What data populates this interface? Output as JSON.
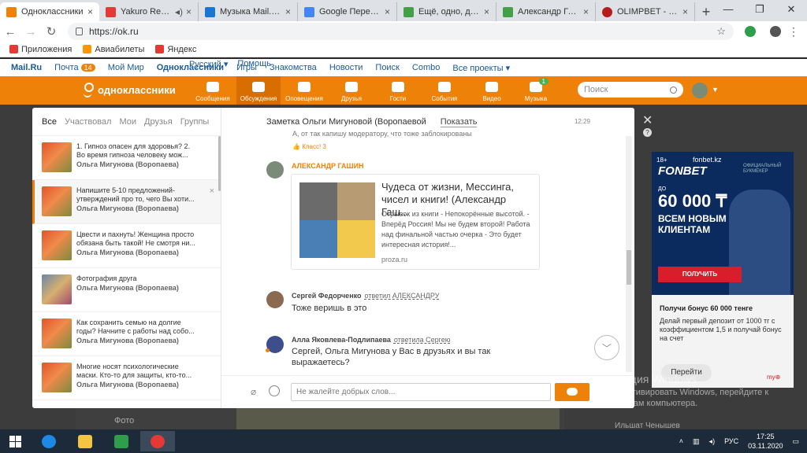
{
  "browser": {
    "tabs": [
      {
        "title": "Одноклассники",
        "color": "#ee8208",
        "active": true
      },
      {
        "title": "Yakuro Return",
        "color": "#e53935"
      },
      {
        "title": "Музыка Mail.Ru – ",
        "color": "#1976d2"
      },
      {
        "title": "Google Переводч",
        "color": "#4285f4"
      },
      {
        "title": "Ещё, одно, доказ",
        "color": "#43a047"
      },
      {
        "title": "Александр Гашин",
        "color": "#43a047"
      },
      {
        "title": "OLIMPBET - Списо",
        "color": "#b71c1c"
      }
    ],
    "newtab": "+",
    "url": "https://ok.ru",
    "bookmarks": [
      {
        "label": "Приложения",
        "color": "#e53935"
      },
      {
        "label": "Авиабилеты",
        "color": "#ff9800"
      },
      {
        "label": "Яндекс",
        "color": "#e53935"
      }
    ]
  },
  "portal": {
    "left": [
      "Mail.Ru",
      "Почта",
      "Мой Мир",
      "Одноклассники",
      "Игры",
      "Знакомства",
      "Новости",
      "Поиск",
      "Combo",
      "Все проекты ▾"
    ],
    "mail_count": "14",
    "lang": "Русский ▾",
    "help": "Помощь"
  },
  "ok": {
    "logo": "одноклассники",
    "nav": [
      {
        "label": "Сообщения"
      },
      {
        "label": "Обсуждения",
        "active": true
      },
      {
        "label": "Оповещения"
      },
      {
        "label": "Друзья"
      },
      {
        "label": "Гости"
      },
      {
        "label": "События"
      },
      {
        "label": "Видео"
      },
      {
        "label": "Музыка",
        "count": "1"
      }
    ],
    "search_placeholder": "Поиск"
  },
  "discussions": {
    "tabs": [
      "Все",
      "Участвовал",
      "Мои",
      "Друзья",
      "Группы"
    ],
    "items": [
      {
        "line1": "1. Гипноз опасен для здоровья? 2.",
        "line2": "Во время гипноза человеку мож...",
        "author": "Ольга Мигунова (Воропаева)"
      },
      {
        "line1": "Напишите 5-10 предложений-",
        "line2": "утверждений про то, чего Вы хоти...",
        "author": "Ольга Мигунова (Воропаева)",
        "selected": true
      },
      {
        "line1": "Цвести и пахнуть! Женщина просто",
        "line2": "обязана быть такой! Не смотря ни...",
        "author": "Ольга Мигунова (Воропаева)"
      },
      {
        "line1": "Фотография друга",
        "line2": "",
        "author": "Ольга Мигунова (Воропаева)"
      },
      {
        "line1": "Как сохранить семью на долгие",
        "line2": "годы? Начните с работы над собо...",
        "author": "Ольга Мигунова (Воропаева)"
      },
      {
        "line1": "Многие носят психологические",
        "line2": "маски. Кто-то для защиты, кто-то...",
        "author": "Ольга Мигунова (Воропаева)"
      }
    ],
    "close": "×"
  },
  "thread": {
    "title": "Заметка Ольги Мигуновой (Воропаевой",
    "show": "Показать",
    "time": "12:29",
    "prev_text": "А, от так капишу модератору, что тоже заблокированы",
    "class_label": "Класс! 3",
    "post_author": "АЛЕКСАНДР ГАШИН",
    "card": {
      "title": "Чудеса от жизни, Мессинга, чисел и книги! (Александр Гаш...",
      "desc": "Отрывок из книги - Непокорённые высотой. - Вперёд Россия! Мы не будем второй! Работа над финальной частью очерка - Это будет интересная история!...",
      "source": "proza.ru"
    },
    "messages": [
      {
        "author": "Сергей Федорченко",
        "reply": "ответил АЛЕКСАНДРУ",
        "text": "Тоже веришь в это"
      },
      {
        "author": "Алла Яковлева-Подлипаева",
        "reply": "ответила Сергею",
        "text": "Сергей, Ольга Мигунова у Вас в друзьях и вы так выражаетесь?"
      }
    ],
    "input_placeholder": "Не жалейте добрых слов..."
  },
  "ad": {
    "age": "18+",
    "domain": "fonbet.kz",
    "brand": "FONBET",
    "official": "ОФИЦИАЛЬНЫЙ БУКМЕКЕР",
    "do": "ДО",
    "amount": "60 000 ₸",
    "line1": "ВСЕМ НОВЫМ",
    "line2": "КЛИЕНТАМ",
    "get": "ПОЛУЧИТЬ",
    "headline": "Получи бонус 60 000 тенге",
    "desc": "Делай первый депозит от 1000 тг с коэффициентом 1,5 и получай бонус на счет",
    "go": "Перейти",
    "mark": "my⊕"
  },
  "background": {
    "photo_label": "Фото",
    "user": "Ильшат Ченышев"
  },
  "windows": {
    "activate_title": "Активация Windows",
    "activate_desc": "Чтобы активировать Windows, перейдите к параметрам компьютера.",
    "lang": "РУС",
    "time": "17:25",
    "date": "03.11.2020"
  }
}
